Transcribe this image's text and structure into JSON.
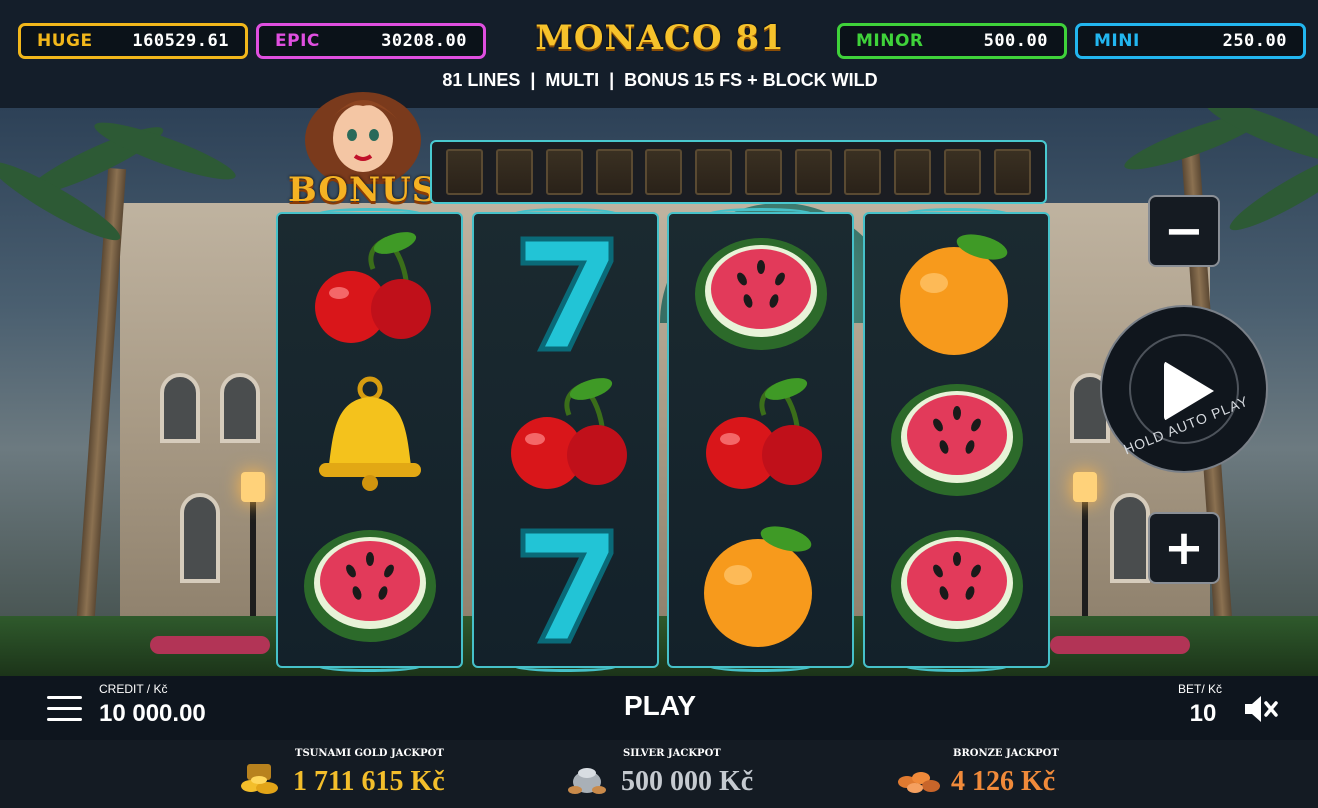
{
  "jackpots_top": [
    {
      "name": "HUGE",
      "value": "160529.61",
      "color": "#f2b71b"
    },
    {
      "name": "EPIC",
      "value": "30208.00",
      "color": "#e04fe0"
    },
    {
      "name": "MINOR",
      "value": "500.00",
      "color": "#3fd23a"
    },
    {
      "name": "MINI",
      "value": "250.00",
      "color": "#22b6f0"
    }
  ],
  "header": {
    "title": "MONACO 81",
    "subtitle": "81 LINES  |  MULTI  |  BONUS 15 FS + BLOCK WILD"
  },
  "bonus": {
    "label": "BONUS",
    "slots_total": 12,
    "slots_filled": 0
  },
  "reels": [
    [
      "cherry",
      "bell",
      "watermelon"
    ],
    [
      "seven",
      "cherry",
      "seven"
    ],
    [
      "watermelon",
      "cherry",
      "orange"
    ],
    [
      "orange",
      "watermelon",
      "watermelon"
    ]
  ],
  "controls": {
    "minus_label": "−",
    "plus_label": "+",
    "spin_hint": "HOLD AUTO PLAY",
    "menu_icon": "hamburger-icon",
    "mute_icon": "speaker-muted-icon"
  },
  "status": {
    "credit_label": "CREDIT / Kč",
    "credit_value": "10 000.00",
    "play_label": "PLAY",
    "bet_label": "BET/ Kč",
    "bet_value": "10"
  },
  "progressive_jackpots": [
    {
      "label": "TSUNAMI GOLD JACKPOT",
      "amount": "1 711 615 Kč",
      "icon": "gold-coins-icon",
      "color": "#f3be2b"
    },
    {
      "label": "SILVER JACKPOT",
      "amount": "500 000 Kč",
      "icon": "silver-pot-icon",
      "color": "#c5cad0"
    },
    {
      "label": "BRONZE JACKPOT",
      "amount": "4 126 Kč",
      "icon": "bronze-coins-icon",
      "color": "#f08a3a"
    }
  ]
}
